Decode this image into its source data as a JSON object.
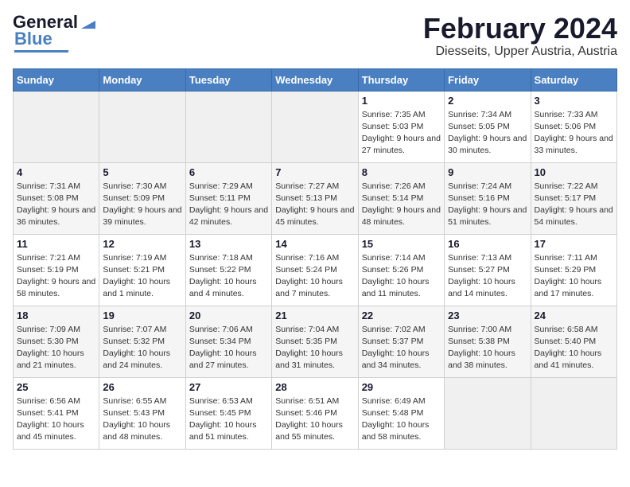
{
  "header": {
    "logo_line1": "General",
    "logo_line2": "Blue",
    "title": "February 2024",
    "subtitle": "Diesseits, Upper Austria, Austria"
  },
  "calendar": {
    "days_of_week": [
      "Sunday",
      "Monday",
      "Tuesday",
      "Wednesday",
      "Thursday",
      "Friday",
      "Saturday"
    ],
    "weeks": [
      [
        {
          "day": "",
          "info": ""
        },
        {
          "day": "",
          "info": ""
        },
        {
          "day": "",
          "info": ""
        },
        {
          "day": "",
          "info": ""
        },
        {
          "day": "1",
          "info": "Sunrise: 7:35 AM\nSunset: 5:03 PM\nDaylight: 9 hours and 27 minutes."
        },
        {
          "day": "2",
          "info": "Sunrise: 7:34 AM\nSunset: 5:05 PM\nDaylight: 9 hours and 30 minutes."
        },
        {
          "day": "3",
          "info": "Sunrise: 7:33 AM\nSunset: 5:06 PM\nDaylight: 9 hours and 33 minutes."
        }
      ],
      [
        {
          "day": "4",
          "info": "Sunrise: 7:31 AM\nSunset: 5:08 PM\nDaylight: 9 hours and 36 minutes."
        },
        {
          "day": "5",
          "info": "Sunrise: 7:30 AM\nSunset: 5:09 PM\nDaylight: 9 hours and 39 minutes."
        },
        {
          "day": "6",
          "info": "Sunrise: 7:29 AM\nSunset: 5:11 PM\nDaylight: 9 hours and 42 minutes."
        },
        {
          "day": "7",
          "info": "Sunrise: 7:27 AM\nSunset: 5:13 PM\nDaylight: 9 hours and 45 minutes."
        },
        {
          "day": "8",
          "info": "Sunrise: 7:26 AM\nSunset: 5:14 PM\nDaylight: 9 hours and 48 minutes."
        },
        {
          "day": "9",
          "info": "Sunrise: 7:24 AM\nSunset: 5:16 PM\nDaylight: 9 hours and 51 minutes."
        },
        {
          "day": "10",
          "info": "Sunrise: 7:22 AM\nSunset: 5:17 PM\nDaylight: 9 hours and 54 minutes."
        }
      ],
      [
        {
          "day": "11",
          "info": "Sunrise: 7:21 AM\nSunset: 5:19 PM\nDaylight: 9 hours and 58 minutes."
        },
        {
          "day": "12",
          "info": "Sunrise: 7:19 AM\nSunset: 5:21 PM\nDaylight: 10 hours and 1 minute."
        },
        {
          "day": "13",
          "info": "Sunrise: 7:18 AM\nSunset: 5:22 PM\nDaylight: 10 hours and 4 minutes."
        },
        {
          "day": "14",
          "info": "Sunrise: 7:16 AM\nSunset: 5:24 PM\nDaylight: 10 hours and 7 minutes."
        },
        {
          "day": "15",
          "info": "Sunrise: 7:14 AM\nSunset: 5:26 PM\nDaylight: 10 hours and 11 minutes."
        },
        {
          "day": "16",
          "info": "Sunrise: 7:13 AM\nSunset: 5:27 PM\nDaylight: 10 hours and 14 minutes."
        },
        {
          "day": "17",
          "info": "Sunrise: 7:11 AM\nSunset: 5:29 PM\nDaylight: 10 hours and 17 minutes."
        }
      ],
      [
        {
          "day": "18",
          "info": "Sunrise: 7:09 AM\nSunset: 5:30 PM\nDaylight: 10 hours and 21 minutes."
        },
        {
          "day": "19",
          "info": "Sunrise: 7:07 AM\nSunset: 5:32 PM\nDaylight: 10 hours and 24 minutes."
        },
        {
          "day": "20",
          "info": "Sunrise: 7:06 AM\nSunset: 5:34 PM\nDaylight: 10 hours and 27 minutes."
        },
        {
          "day": "21",
          "info": "Sunrise: 7:04 AM\nSunset: 5:35 PM\nDaylight: 10 hours and 31 minutes."
        },
        {
          "day": "22",
          "info": "Sunrise: 7:02 AM\nSunset: 5:37 PM\nDaylight: 10 hours and 34 minutes."
        },
        {
          "day": "23",
          "info": "Sunrise: 7:00 AM\nSunset: 5:38 PM\nDaylight: 10 hours and 38 minutes."
        },
        {
          "day": "24",
          "info": "Sunrise: 6:58 AM\nSunset: 5:40 PM\nDaylight: 10 hours and 41 minutes."
        }
      ],
      [
        {
          "day": "25",
          "info": "Sunrise: 6:56 AM\nSunset: 5:41 PM\nDaylight: 10 hours and 45 minutes."
        },
        {
          "day": "26",
          "info": "Sunrise: 6:55 AM\nSunset: 5:43 PM\nDaylight: 10 hours and 48 minutes."
        },
        {
          "day": "27",
          "info": "Sunrise: 6:53 AM\nSunset: 5:45 PM\nDaylight: 10 hours and 51 minutes."
        },
        {
          "day": "28",
          "info": "Sunrise: 6:51 AM\nSunset: 5:46 PM\nDaylight: 10 hours and 55 minutes."
        },
        {
          "day": "29",
          "info": "Sunrise: 6:49 AM\nSunset: 5:48 PM\nDaylight: 10 hours and 58 minutes."
        },
        {
          "day": "",
          "info": ""
        },
        {
          "day": "",
          "info": ""
        }
      ]
    ]
  }
}
